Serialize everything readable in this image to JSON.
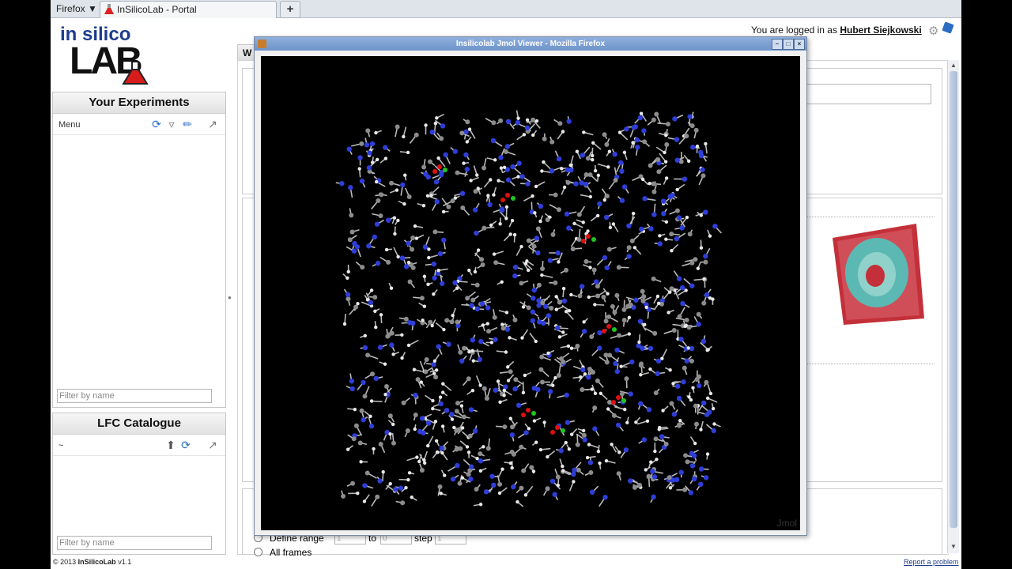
{
  "browser": {
    "menu_label": "Firefox",
    "tab_title": "InSilicoLab - Portal",
    "new_tab_symbol": "+"
  },
  "logo": {
    "line1": "in silico",
    "line2": "LAB"
  },
  "header": {
    "login_prefix": "You are logged in as",
    "user_name": "Hubert Siejkowski"
  },
  "experiments_panel": {
    "title": "Your Experiments",
    "menu_label": "Menu",
    "filter_placeholder": "Filter by name"
  },
  "lfc_panel": {
    "title": "LFC Catalogue",
    "path": "~",
    "filter_placeholder": "Filter by name"
  },
  "workspace": {
    "tab_label": "W"
  },
  "popup": {
    "title": "Insilicolab Jmol Viewer - Mozilla Firefox",
    "viewer_label": "Jmol"
  },
  "frames": {
    "define_range_label": "Define range",
    "range_from": "1",
    "to_label": "to",
    "range_to": "0",
    "step_label": "step",
    "range_step": "1",
    "all_frames_label": "All frames"
  },
  "footer": {
    "copyright_prefix": "© 2013",
    "copyright_name": "InSilicoLab",
    "version": "v1.1",
    "report_link": "Report a problem"
  },
  "colors": {
    "carbon": "#8c8c8c",
    "hydrogen": "#e8e8e8",
    "nitrogen": "#2e3ed8",
    "oxygen": "#e01010",
    "chlorine": "#1ec81e",
    "accent": "#1d3d8c"
  }
}
